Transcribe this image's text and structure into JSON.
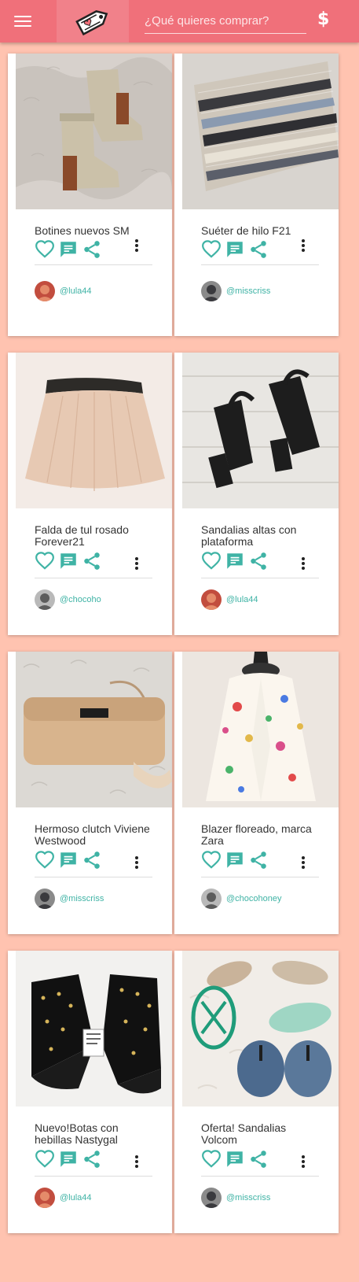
{
  "header": {
    "search_placeholder": "¿Qué quieres comprar?",
    "currency_symbol": "$",
    "bar_color": "#f0707a"
  },
  "accent_color": "#3fb3a5",
  "products": [
    {
      "title": "Botines nuevos SM",
      "user": "@lula44"
    },
    {
      "title": "Suéter de hilo F21",
      "user": "@misscriss"
    },
    {
      "title": "Falda de tul rosado Forever21",
      "user": "@chocoho"
    },
    {
      "title": "Sandalias altas con plataforma",
      "user": "@lula44"
    },
    {
      "title": "Hermoso clutch Viviene Westwood",
      "user": "@misscriss"
    },
    {
      "title": "Blazer floreado, marca Zara",
      "user": "@chocohoney"
    },
    {
      "title": "Nuevo!Botas con hebillas Nastygal",
      "user": "@lula44"
    },
    {
      "title": "Oferta! Sandalias Volcom",
      "user": "@misscriss"
    }
  ],
  "icons": [
    "menu-icon",
    "tag-logo",
    "dollar-icon",
    "heart-icon",
    "comment-icon",
    "share-icon",
    "more-vert-icon"
  ]
}
